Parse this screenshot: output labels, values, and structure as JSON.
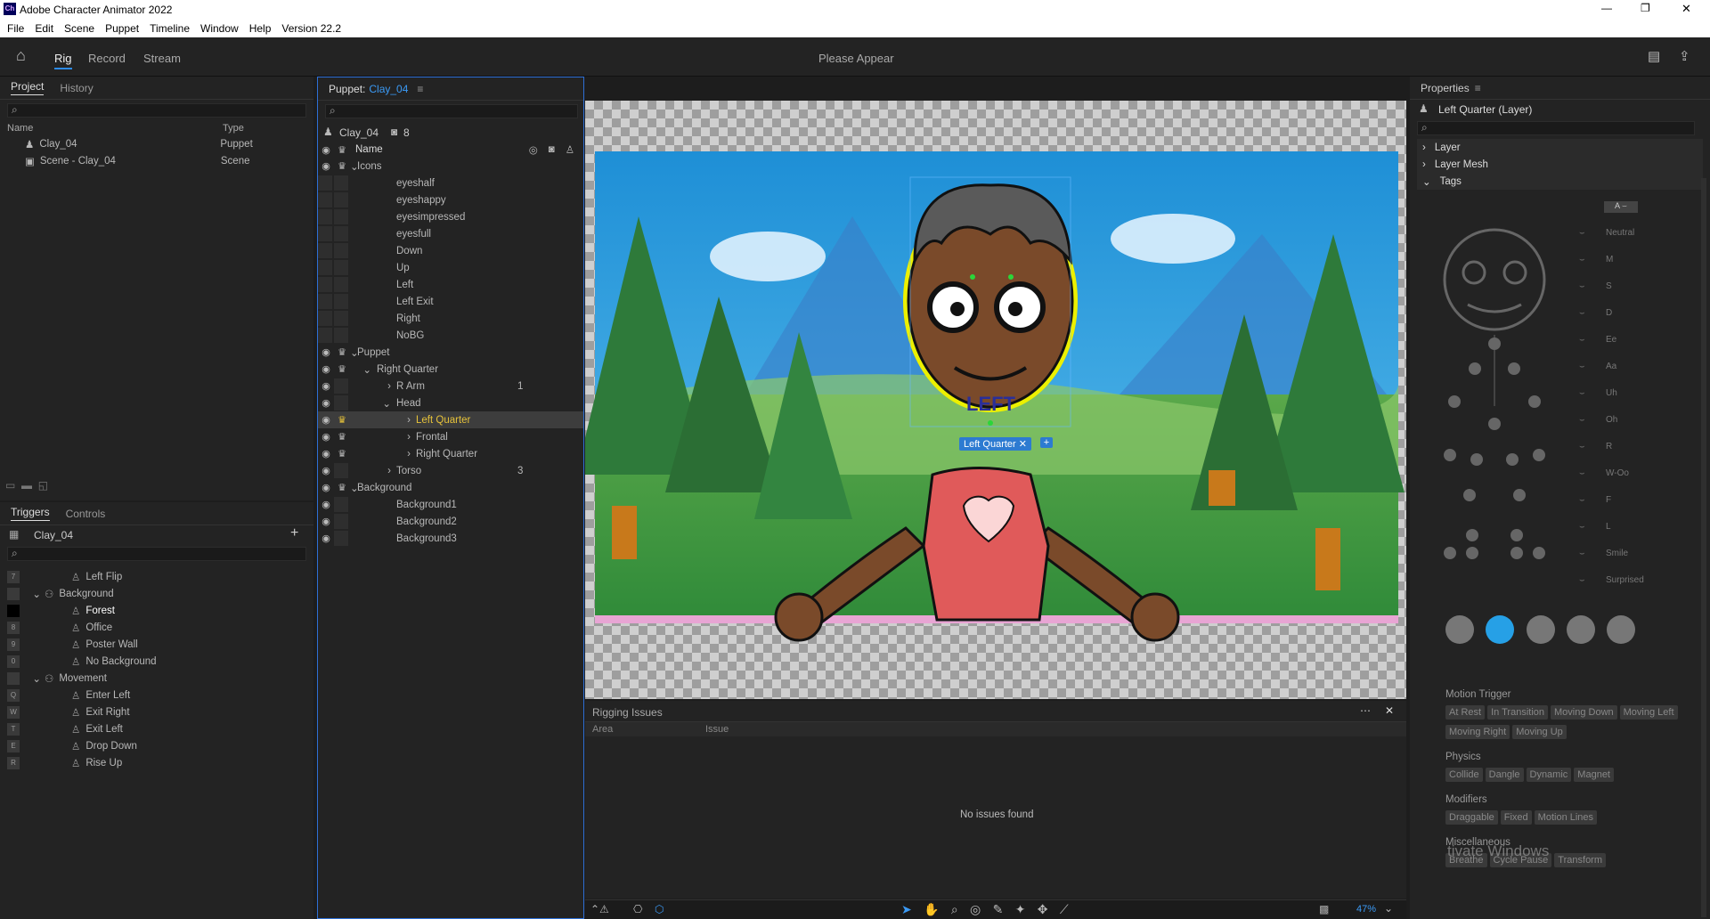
{
  "window": {
    "title": "Adobe Character Animator 2022",
    "app_icon": "Ch",
    "controls": [
      "—",
      "❐",
      "✕"
    ]
  },
  "menu": [
    "File",
    "Edit",
    "Scene",
    "Puppet",
    "Timeline",
    "Window",
    "Help",
    "Version 22.2"
  ],
  "workspace": {
    "tabs": [
      "Rig",
      "Record",
      "Stream"
    ],
    "active": "Rig",
    "center_title": "Please Appear"
  },
  "project": {
    "tabs": [
      "Project",
      "History"
    ],
    "col_name": "Name",
    "col_type": "Type",
    "items": [
      {
        "name": "Clay_04",
        "type": "Puppet"
      },
      {
        "name": "Scene - Clay_04",
        "type": "Scene"
      }
    ]
  },
  "triggers": {
    "tabs": [
      "Triggers",
      "Controls"
    ],
    "puppet": "Clay_04",
    "rows": [
      {
        "key": "7",
        "label": "Left Flip",
        "indent": 2
      },
      {
        "key": "",
        "label": "Background",
        "indent": 1,
        "group": true
      },
      {
        "key": "",
        "label": "Forest",
        "indent": 2,
        "selected": true
      },
      {
        "key": "8",
        "label": "Office",
        "indent": 2
      },
      {
        "key": "9",
        "label": "Poster Wall",
        "indent": 2
      },
      {
        "key": "0",
        "label": "No Background",
        "indent": 2
      },
      {
        "key": "",
        "label": "Movement",
        "indent": 1,
        "group": true
      },
      {
        "key": "Q",
        "label": "Enter Left",
        "indent": 2
      },
      {
        "key": "W",
        "label": "Exit Right",
        "indent": 2
      },
      {
        "key": "T",
        "label": "Exit Left",
        "indent": 2
      },
      {
        "key": "E",
        "label": "Drop Down",
        "indent": 2
      },
      {
        "key": "R",
        "label": "Rise Up",
        "indent": 2
      }
    ]
  },
  "puppet": {
    "header": "Puppet:",
    "name": "Clay_04",
    "subname": "Clay_04",
    "count": "8",
    "col_name": "Name",
    "rows": [
      {
        "label": "Icons",
        "indent": 0,
        "arrow": "⌄",
        "eye": true,
        "crown": true,
        "num": ""
      },
      {
        "label": "eyeshalf",
        "indent": 2
      },
      {
        "label": "eyeshappy",
        "indent": 2
      },
      {
        "label": "eyesimpressed",
        "indent": 2
      },
      {
        "label": "eyesfull",
        "indent": 2
      },
      {
        "label": "Down",
        "indent": 2
      },
      {
        "label": "Up",
        "indent": 2
      },
      {
        "label": "Left",
        "indent": 2
      },
      {
        "label": "Left Exit",
        "indent": 2
      },
      {
        "label": "Right",
        "indent": 2
      },
      {
        "label": "NoBG",
        "indent": 2
      },
      {
        "label": "Puppet",
        "indent": 0,
        "arrow": "⌄",
        "eye": true,
        "crown": true
      },
      {
        "label": "Right Quarter",
        "indent": 1,
        "arrow": "⌄",
        "eye": true,
        "crown": true
      },
      {
        "label": "R Arm",
        "indent": 2,
        "arrow": "›",
        "eye": true,
        "num": "1"
      },
      {
        "label": "Head",
        "indent": 2,
        "arrow": "⌄",
        "eye": true
      },
      {
        "label": "Left Quarter",
        "indent": 3,
        "arrow": "›",
        "eye": true,
        "crown": true,
        "selected": true
      },
      {
        "label": "Frontal",
        "indent": 3,
        "arrow": "›",
        "eye": true,
        "crown": true
      },
      {
        "label": "Right Quarter",
        "indent": 3,
        "arrow": "›",
        "eye": true,
        "crown": true
      },
      {
        "label": "Torso",
        "indent": 2,
        "arrow": "›",
        "eye": true,
        "num": "3"
      },
      {
        "label": "Background",
        "indent": 0,
        "arrow": "⌄",
        "eye": true,
        "crown": true
      },
      {
        "label": "Background1",
        "indent": 2,
        "eye": true
      },
      {
        "label": "Background2",
        "indent": 2,
        "eye": true
      },
      {
        "label": "Background3",
        "indent": 2,
        "eye": true
      }
    ]
  },
  "scene": {
    "layer_tag": "Left Quarter",
    "mouth_text": "LEFT",
    "overlay_text": "tivate Windows",
    "zoom": "47%"
  },
  "issues": {
    "title": "Rigging Issues",
    "col_area": "Area",
    "col_issue": "Issue",
    "empty": "No issues found"
  },
  "properties": {
    "title": "Properties",
    "layer": "Left Quarter (Layer)",
    "sections": [
      "Layer",
      "Layer Mesh",
      "Tags"
    ],
    "mouth_tags": [
      "Neutral",
      "M",
      "S",
      "D",
      "Ee",
      "Aa",
      "Uh",
      "Oh",
      "R",
      "W-Oo",
      "F",
      "L",
      "Smile",
      "Surprised"
    ],
    "motion_title": "Motion Trigger",
    "motion": [
      "At Rest",
      "In Transition",
      "Moving Down",
      "Moving Left",
      "Moving Right",
      "Moving Up"
    ],
    "physics_title": "Physics",
    "physics": [
      "Collide",
      "Dangle",
      "Dynamic",
      "Magnet"
    ],
    "modifiers_title": "Modifiers",
    "modifiers": [
      "Draggable",
      "Fixed",
      "Motion Lines"
    ],
    "misc_title": "Miscellaneous",
    "misc": [
      "Breathe",
      "Cycle Pause",
      "Transform"
    ]
  }
}
